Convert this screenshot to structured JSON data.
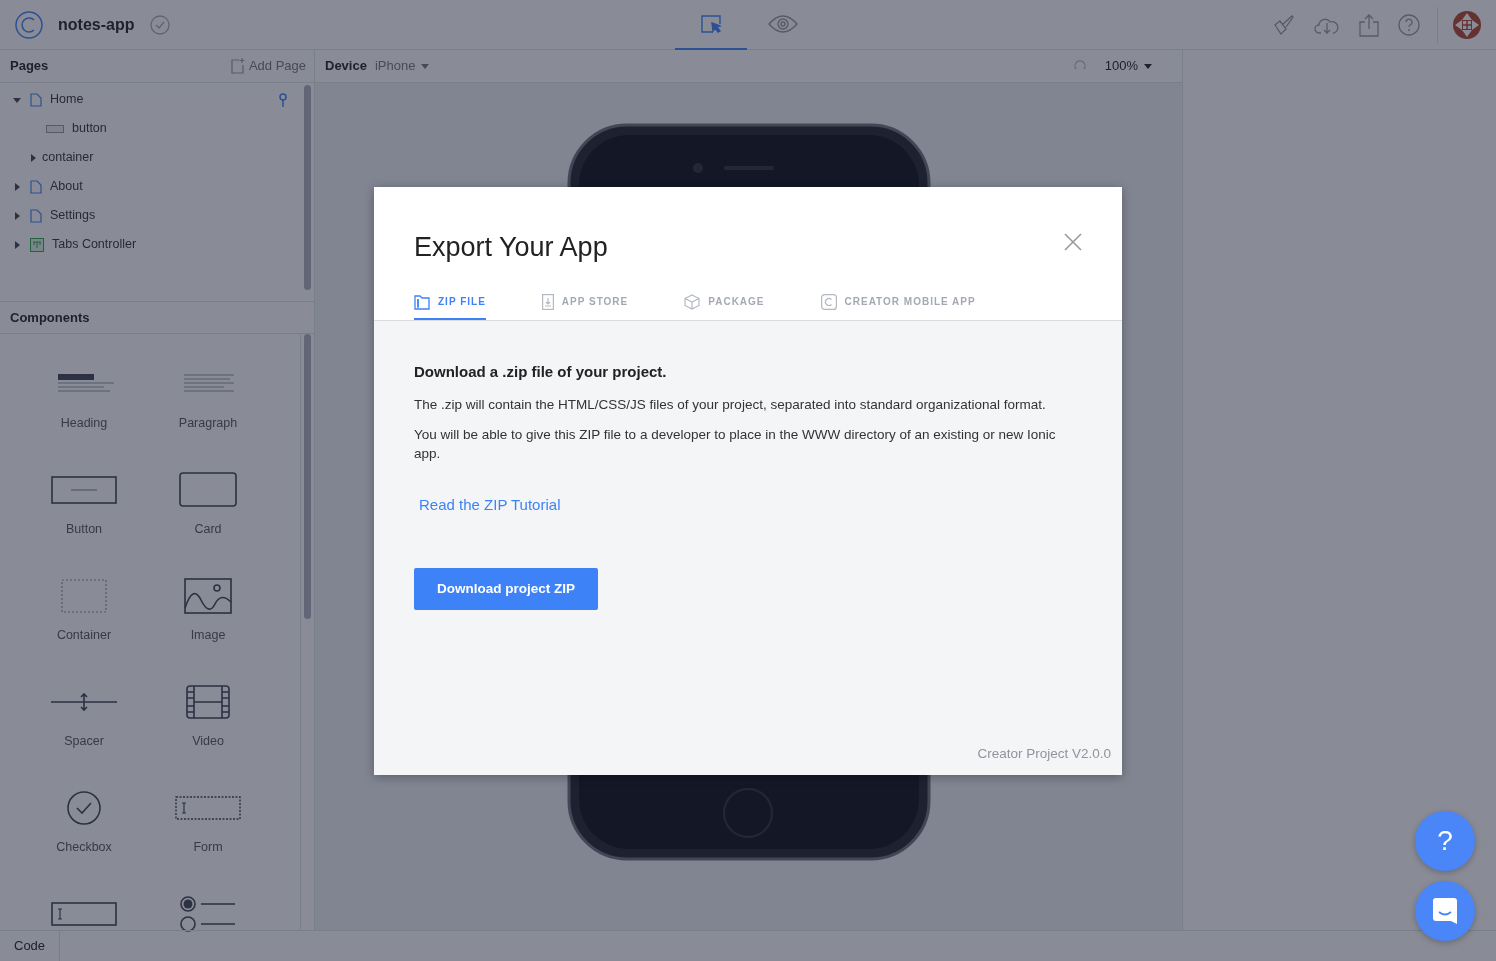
{
  "header": {
    "project_name": "notes-app",
    "modes": [
      {
        "kind": "design",
        "selected": true
      },
      {
        "kind": "preview",
        "selected": false
      }
    ]
  },
  "pages_panel": {
    "title": "Pages",
    "add_label": "Add Page",
    "tree": [
      {
        "label": "Home",
        "kind": "page",
        "expanded": true,
        "pinned": true,
        "children": [
          {
            "label": "button",
            "kind": "element"
          },
          {
            "label": "container",
            "kind": "container",
            "expanded": false
          }
        ]
      },
      {
        "label": "About",
        "kind": "page",
        "expanded": false,
        "pinned": false
      },
      {
        "label": "Settings",
        "kind": "page",
        "expanded": false,
        "pinned": false
      },
      {
        "label": "Tabs Controller",
        "kind": "tabs",
        "expanded": false,
        "pinned": false
      }
    ]
  },
  "components_panel": {
    "title": "Components",
    "items": [
      {
        "label": "Heading",
        "kind": "heading"
      },
      {
        "label": "Paragraph",
        "kind": "paragraph"
      },
      {
        "label": "Button",
        "kind": "button"
      },
      {
        "label": "Card",
        "kind": "card"
      },
      {
        "label": "Container",
        "kind": "container"
      },
      {
        "label": "Image",
        "kind": "image"
      },
      {
        "label": "Spacer",
        "kind": "spacer"
      },
      {
        "label": "Video",
        "kind": "video"
      },
      {
        "label": "Checkbox",
        "kind": "checkbox"
      },
      {
        "label": "Form",
        "kind": "form"
      },
      {
        "kind": "input"
      },
      {
        "kind": "radio"
      }
    ]
  },
  "device_toolbar": {
    "label": "Device",
    "device": "iPhone",
    "zoom": "100%"
  },
  "bottom_bar": {
    "tabs": [
      "Code"
    ]
  },
  "modal": {
    "title": "Export Your App",
    "tabs": [
      {
        "label": "ZIP FILE",
        "kind": "zip",
        "selected": true
      },
      {
        "label": "APP STORE",
        "kind": "store",
        "selected": false
      },
      {
        "label": "PACKAGE",
        "kind": "package",
        "selected": false
      },
      {
        "label": "CREATOR MOBILE APP",
        "kind": "creator",
        "selected": false
      }
    ],
    "heading": "Download a .zip file of your project.",
    "paragraphs": [
      "The .zip will contain the HTML/CSS/JS files of your project, separated into standard organizational format.",
      "You will be able to give this ZIP file to a developer to place in the WWW directory of an existing or new Ionic app."
    ],
    "link": "Read the ZIP Tutorial",
    "button": "Download project ZIP",
    "version": "Creator Project V2.0.0"
  },
  "help_button": "?"
}
